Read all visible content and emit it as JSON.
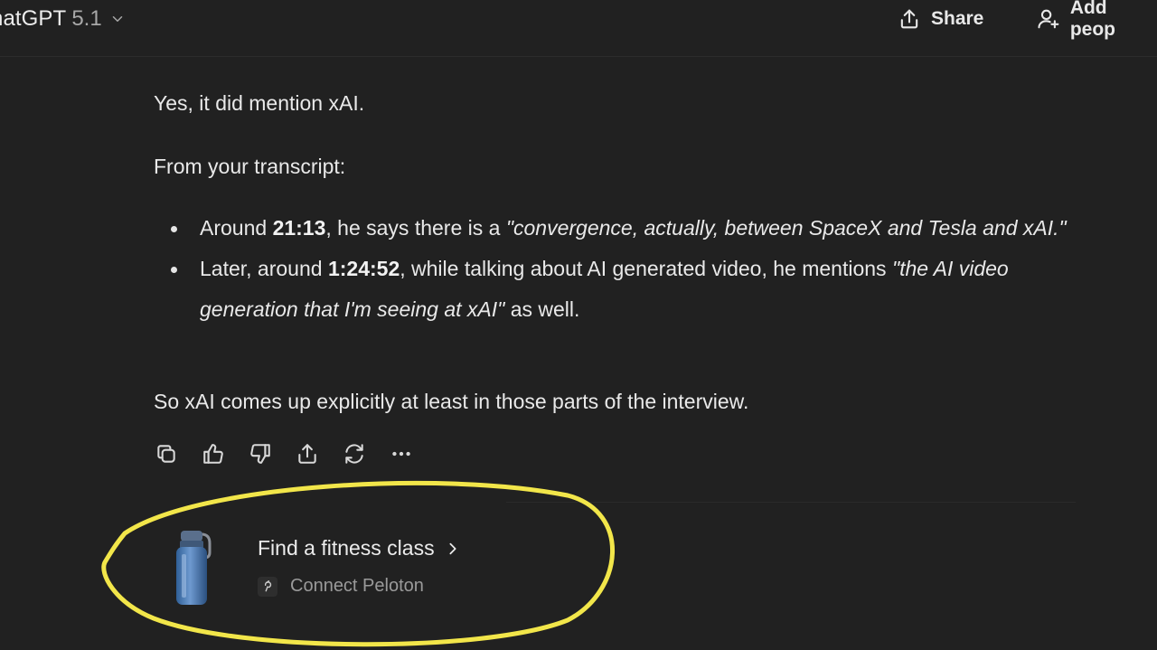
{
  "header": {
    "model_name": "hatGPT",
    "model_version": "5.1",
    "share_label": "Share",
    "add_people_label": "Add peop"
  },
  "message": {
    "line1": "Yes, it did mention xAI.",
    "line2": "From your transcript:",
    "bullets": [
      {
        "pre": "Around ",
        "time": "21:13",
        "mid": ", he says there is a ",
        "quote": "\"convergence, actually, between SpaceX and Tesla and xAI.\"",
        "post": ""
      },
      {
        "pre": "Later, around ",
        "time": "1:24:52",
        "mid": ", while talking about AI generated video, he mentions ",
        "quote": "\"the AI video generation that I'm seeing at xAI\"",
        "post": " as well."
      }
    ],
    "line3": "So xAI comes up explicitly at least in those parts of the interview."
  },
  "actions": [
    {
      "name": "copy-icon"
    },
    {
      "name": "thumbs-up-icon"
    },
    {
      "name": "thumbs-down-icon"
    },
    {
      "name": "share-icon"
    },
    {
      "name": "regenerate-icon"
    },
    {
      "name": "more-icon"
    }
  ],
  "suggestion": {
    "title": "Find a fitness class",
    "subtitle": "Connect Peloton",
    "image_icon": "water-bottle-icon",
    "app_icon": "peloton-icon"
  },
  "colors": {
    "background": "#212121",
    "text": "#e9e9e9",
    "muted": "#9a9a9a",
    "highlight": "#f2e64a"
  }
}
